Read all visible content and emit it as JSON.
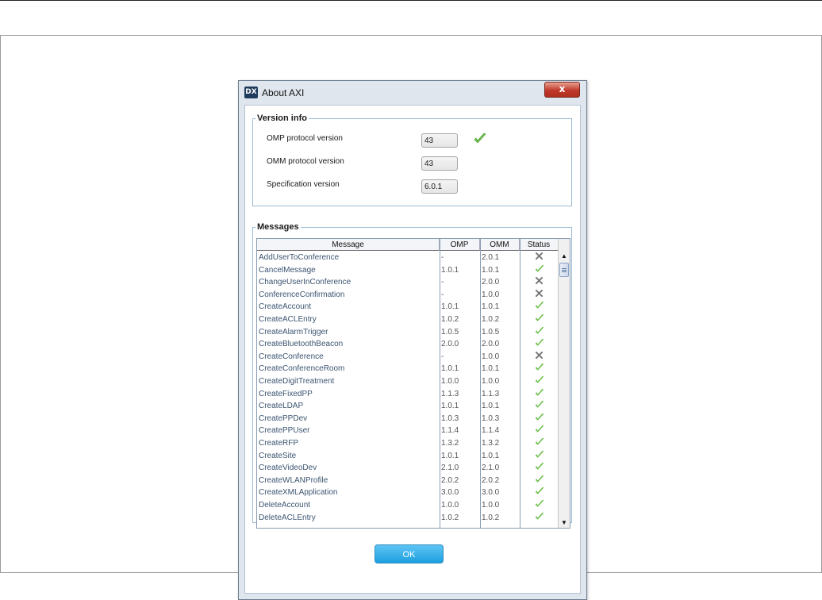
{
  "window": {
    "title": "About AXI",
    "close_label": "x"
  },
  "version_info": {
    "legend": "Version info",
    "fields": [
      {
        "label": "OMP protocol version",
        "value": "43",
        "checked": true
      },
      {
        "label": "OMM protocol version",
        "value": "43"
      },
      {
        "label": "Specification version",
        "value": "6.0.1"
      }
    ]
  },
  "messages": {
    "legend": "Messages",
    "columns": [
      "Message",
      "OMP",
      "OMM",
      "Status"
    ],
    "rows": [
      [
        "AddUserToConference",
        "-",
        "2.0.1",
        "cross"
      ],
      [
        "CancelMessage",
        "1.0.1",
        "1.0.1",
        "check"
      ],
      [
        "ChangeUserInConference",
        "-",
        "2.0.0",
        "cross"
      ],
      [
        "ConferenceConfirmation",
        "-",
        "1.0.0",
        "cross"
      ],
      [
        "CreateAccount",
        "1.0.1",
        "1.0.1",
        "check"
      ],
      [
        "CreateACLEntry",
        "1.0.2",
        "1.0.2",
        "check"
      ],
      [
        "CreateAlarmTrigger",
        "1.0.5",
        "1.0.5",
        "check"
      ],
      [
        "CreateBluetoothBeacon",
        "2.0.0",
        "2.0.0",
        "check"
      ],
      [
        "CreateConference",
        "-",
        "1.0.0",
        "cross"
      ],
      [
        "CreateConferenceRoom",
        "1.0.1",
        "1.0.1",
        "check"
      ],
      [
        "CreateDigitTreatment",
        "1.0.0",
        "1.0.0",
        "check"
      ],
      [
        "CreateFixedPP",
        "1.1.3",
        "1.1.3",
        "check"
      ],
      [
        "CreateLDAP",
        "1.0.1",
        "1.0.1",
        "check"
      ],
      [
        "CreatePPDev",
        "1.0.3",
        "1.0.3",
        "check"
      ],
      [
        "CreatePPUser",
        "1.1.4",
        "1.1.4",
        "check"
      ],
      [
        "CreateRFP",
        "1.3.2",
        "1.3.2",
        "check"
      ],
      [
        "CreateSite",
        "1.0.1",
        "1.0.1",
        "check"
      ],
      [
        "CreateVideoDev",
        "2.1.0",
        "2.1.0",
        "check"
      ],
      [
        "CreateWLANProfile",
        "2.0.2",
        "2.0.2",
        "check"
      ],
      [
        "CreateXMLApplication",
        "3.0.0",
        "3.0.0",
        "check"
      ],
      [
        "DeleteAccount",
        "1.0.0",
        "1.0.0",
        "check"
      ],
      [
        "DeleteACLEntry",
        "1.0.2",
        "1.0.2",
        "check"
      ]
    ]
  },
  "buttons": {
    "ok": "OK"
  },
  "colors": {
    "check": "#6cc04a",
    "cross": "#777777",
    "ok_button": "#1c9fdf"
  }
}
